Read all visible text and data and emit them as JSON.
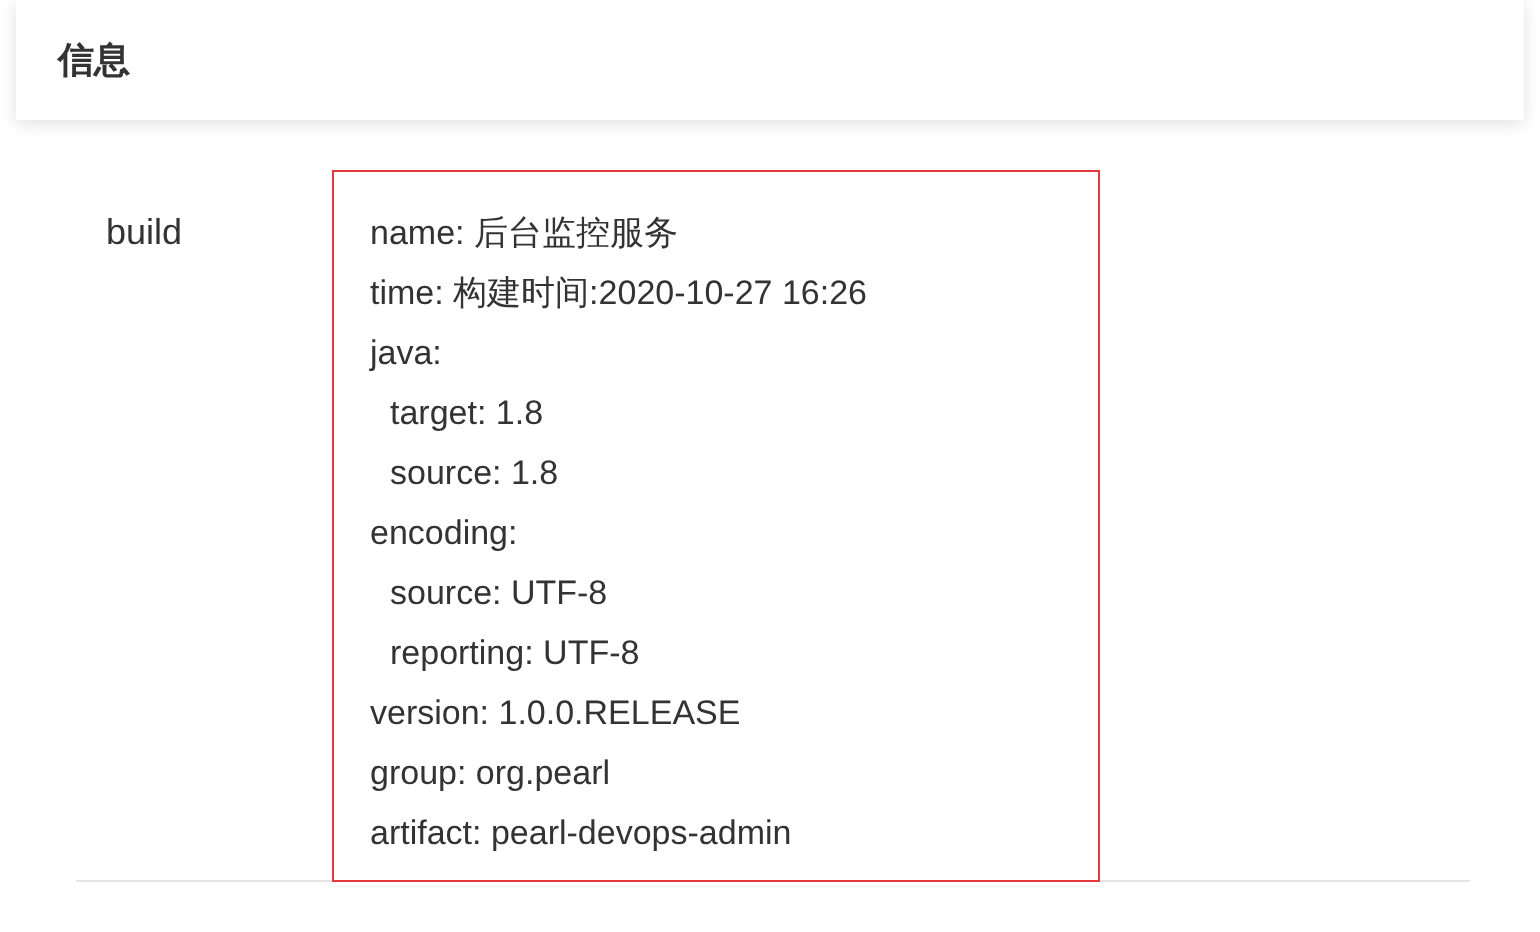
{
  "card": {
    "title": "信息"
  },
  "rows": [
    {
      "label": "build",
      "lines": [
        {
          "text": "name: 后台监控服务"
        },
        {
          "text": "time: 构建时间:2020-10-27 16:26"
        },
        {
          "text": "java:",
          "children": [
            {
              "text": "target: 1.8"
            },
            {
              "text": "source: 1.8"
            }
          ]
        },
        {
          "text": "encoding:",
          "children": [
            {
              "text": "source: UTF-8"
            },
            {
              "text": "reporting: UTF-8"
            }
          ]
        },
        {
          "text": "version: 1.0.0.RELEASE"
        },
        {
          "text": "group: org.pearl"
        },
        {
          "text": "artifact: pearl-devops-admin"
        }
      ]
    }
  ]
}
